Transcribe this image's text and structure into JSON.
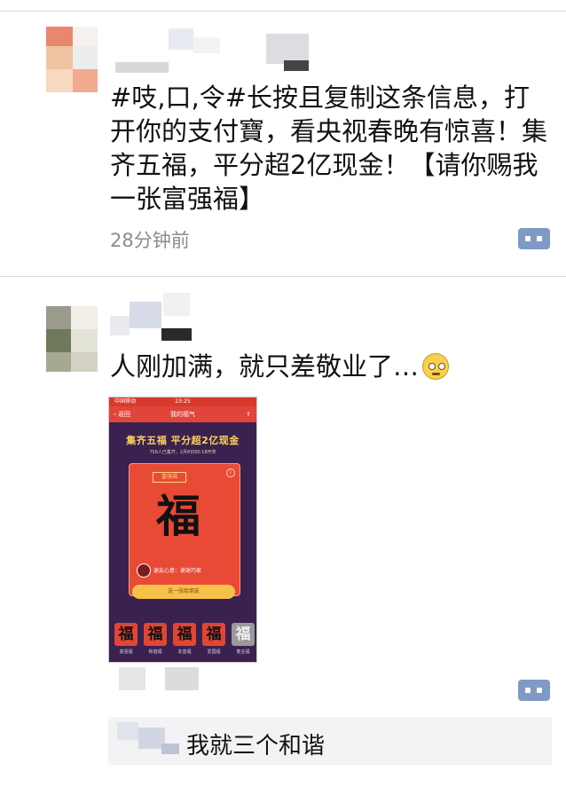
{
  "post1": {
    "text": "#吱,口,令#长按且复制这条信息，打开你的支付寶，看央视春晚有惊喜！集齐五福，平分超2亿现金！【请你赐我一张富强福】",
    "time": "28分钟前"
  },
  "post2": {
    "text": "人刚加满，就只差敬业了…",
    "emoji_icon": "pleading-face-emoji-icon"
  },
  "screenshot": {
    "status_left": "中国移动",
    "status_time": "23:25",
    "nav_back": "‹ 返回",
    "nav_title": "我的福气",
    "nav_share": "⇪",
    "banner_title": "集齐五福 平分超2亿现金",
    "banner_sub": "756人已集齐，2月8日00:18开奖",
    "card_tag": "富强福",
    "card_info": "i",
    "card_char": "福",
    "card_giver": "谢友心意：谢谢巧家",
    "gold_button": "送一张给朋友",
    "fu_tiles": [
      {
        "char": "福",
        "label": "富强福"
      },
      {
        "char": "福",
        "label": "和谐福"
      },
      {
        "char": "福",
        "label": "友善福"
      },
      {
        "char": "福",
        "label": "爱国福"
      },
      {
        "char": "福",
        "label": "敬业福"
      }
    ]
  },
  "reply": {
    "text": "我就三个和谐"
  },
  "colors": {
    "comment_button": "#7f9ac4",
    "timestamp": "#8c8c8c",
    "reply_bg": "#f3f3f5"
  }
}
